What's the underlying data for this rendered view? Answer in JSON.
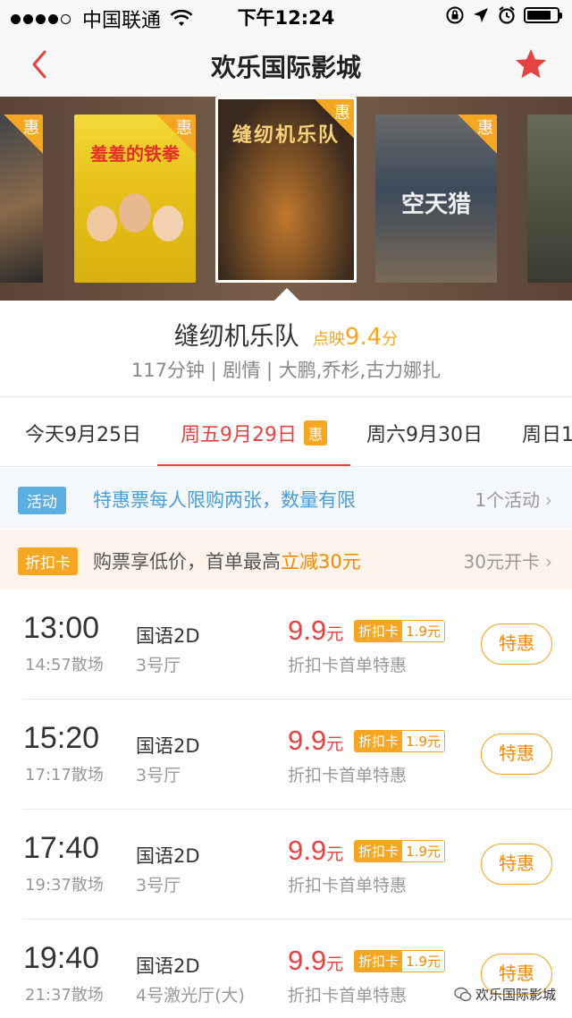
{
  "status_bar": {
    "carrier": "中国联通",
    "time": "下午12:24"
  },
  "nav": {
    "title": "欢乐国际影城",
    "back_icon": "chevron-left-icon",
    "favorite_icon": "star-icon"
  },
  "posters": [
    {
      "title": "",
      "badge": "惠",
      "colors": [
        "#2c3a4a",
        "#8a6a4a"
      ]
    },
    {
      "title": "羞羞的铁拳",
      "badge": "惠",
      "colors": [
        "#e8c21a",
        "#f3da3a"
      ]
    },
    {
      "title": "缝纫机乐队",
      "badge": "惠",
      "colors": [
        "#3a2a1e",
        "#c0782e"
      ]
    },
    {
      "title": "空天猎",
      "badge": "惠",
      "colors": [
        "#3c4a5a",
        "#7a6a58"
      ]
    },
    {
      "title": "",
      "badge": "",
      "colors": [
        "#3a3a30",
        "#6a6a58"
      ]
    }
  ],
  "movie": {
    "name": "缝纫机乐队",
    "rating_prefix": "点映",
    "rating": "9.4",
    "rating_unit": "分",
    "meta": "117分钟 | 剧情 | 大鹏,乔杉,古力娜扎"
  },
  "dates": [
    {
      "label": "今天9月25日",
      "badge": ""
    },
    {
      "label": "周五9月29日",
      "badge": "惠"
    },
    {
      "label": "周六9月30日",
      "badge": ""
    },
    {
      "label": "周日1",
      "badge": ""
    }
  ],
  "activity": {
    "tag": "活动",
    "text": "特惠票每人限购两张，数量有限",
    "right": "1个活动"
  },
  "discount_card": {
    "tag": "折扣卡",
    "text_prefix": "购票享低价，首单最高",
    "text_highlight": "立减30元",
    "right": "30元开卡"
  },
  "showtimes": [
    {
      "start": "13:00",
      "end": "14:57散场",
      "lang": "国语2D",
      "hall": "3号厅",
      "price": "9.9",
      "price_unit": "元",
      "card_label": "折扣卡",
      "card_price": "1.9元",
      "note": "折扣卡首单特惠",
      "button": "特惠"
    },
    {
      "start": "15:20",
      "end": "17:17散场",
      "lang": "国语2D",
      "hall": "3号厅",
      "price": "9.9",
      "price_unit": "元",
      "card_label": "折扣卡",
      "card_price": "1.9元",
      "note": "折扣卡首单特惠",
      "button": "特惠"
    },
    {
      "start": "17:40",
      "end": "19:37散场",
      "lang": "国语2D",
      "hall": "3号厅",
      "price": "9.9",
      "price_unit": "元",
      "card_label": "折扣卡",
      "card_price": "1.9元",
      "note": "折扣卡首单特惠",
      "button": "特惠"
    },
    {
      "start": "19:40",
      "end": "21:37散场",
      "lang": "国语2D",
      "hall": "4号激光厅(大)",
      "price": "9.9",
      "price_unit": "元",
      "card_label": "折扣卡",
      "card_price": "1.9元",
      "note": "折扣卡首单特惠",
      "button": "特惠"
    }
  ],
  "watermark": "欢乐国际影城",
  "colors": {
    "accent_red": "#e54242",
    "accent_orange": "#f5a623",
    "link_blue": "#4a9fd8"
  }
}
